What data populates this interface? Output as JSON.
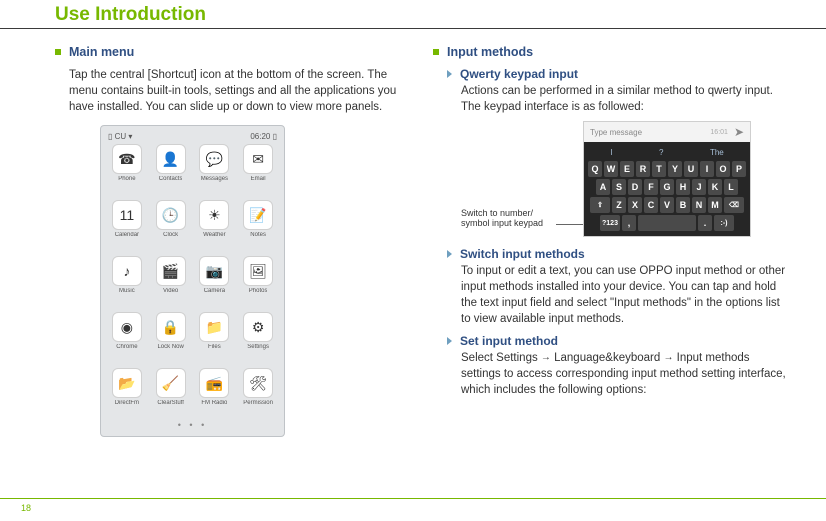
{
  "page_number": "18",
  "title": "Use Introduction",
  "left": {
    "heading": "Main menu",
    "body": "Tap the central [Shortcut] icon at the bottom of the screen. The menu contains built-in tools, settings and all the applications you have installed. You can slide up or down to view more panels.",
    "phone": {
      "status_left": "▯ CU ▾",
      "status_right": "06:20 ▯",
      "apps": [
        {
          "glyph": "☎",
          "label": "Phone"
        },
        {
          "glyph": "👤",
          "label": "Contacts"
        },
        {
          "glyph": "💬",
          "label": "Messages"
        },
        {
          "glyph": "✉",
          "label": "Email"
        },
        {
          "glyph": "11",
          "label": "Calendar"
        },
        {
          "glyph": "🕒",
          "label": "Clock"
        },
        {
          "glyph": "☀",
          "label": "Weather"
        },
        {
          "glyph": "📝",
          "label": "Notes"
        },
        {
          "glyph": "♪",
          "label": "Music"
        },
        {
          "glyph": "🎬",
          "label": "Video"
        },
        {
          "glyph": "📷",
          "label": "Camera"
        },
        {
          "glyph": "🖼",
          "label": "Photos"
        },
        {
          "glyph": "◉",
          "label": "Chrome"
        },
        {
          "glyph": "🔒",
          "label": "Lock Now"
        },
        {
          "glyph": "📁",
          "label": "Files"
        },
        {
          "glyph": "⚙",
          "label": "Settings"
        },
        {
          "glyph": "📂",
          "label": "DirectFm"
        },
        {
          "glyph": "🧹",
          "label": "ClearStuff"
        },
        {
          "glyph": "📻",
          "label": "FM Radio"
        },
        {
          "glyph": "🛠",
          "label": "Permission"
        }
      ],
      "dots": "• • •"
    }
  },
  "right": {
    "heading": "Input methods",
    "sub1": {
      "title": "Qwerty keypad input",
      "body": "Actions can be performed in a similar method to qwerty input. The keypad interface is as followed:"
    },
    "kb": {
      "caption": "Switch to number/ symbol input keypad",
      "status_right": "16:01",
      "placeholder": "Type message",
      "sugg": [
        "I",
        "?",
        "The"
      ],
      "row1": [
        "Q",
        "W",
        "E",
        "R",
        "T",
        "Y",
        "U",
        "I",
        "O",
        "P"
      ],
      "row2": [
        "A",
        "S",
        "D",
        "F",
        "G",
        "H",
        "J",
        "K",
        "L"
      ],
      "row3_shift": "⇧",
      "row3": [
        "Z",
        "X",
        "C",
        "V",
        "B",
        "N",
        "M"
      ],
      "row3_del": "⌫",
      "row4": {
        "numkey": "?123",
        "comma": ",",
        "space": "",
        "dot": ".",
        "enter": ":-)"
      }
    },
    "sub2": {
      "title": "Switch input methods",
      "body": "To input or edit a text, you can use OPPO input method or other input methods installed into your device. You can tap and hold the text input field and select \"Input methods\" in the options list to view available input methods."
    },
    "sub3": {
      "title": "Set input method",
      "body_pre": "Select Settings ",
      "body_mid": "Language&keyboard ",
      "body_post": " Input methods settings to access corresponding input method setting interface, which includes the following options:",
      "arrow": "→"
    }
  }
}
